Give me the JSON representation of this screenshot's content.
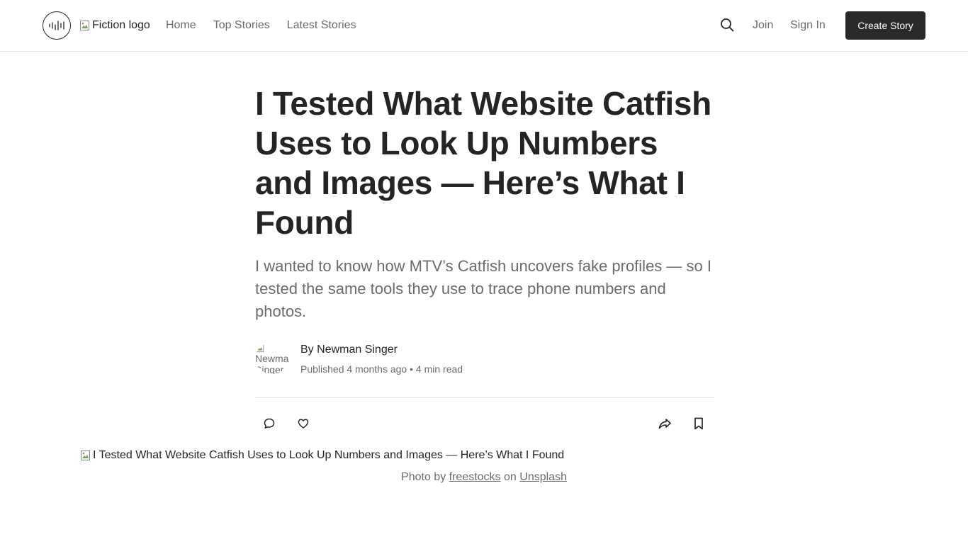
{
  "header": {
    "logo_alt": "Fiction logo",
    "nav": [
      "Home",
      "Top Stories",
      "Latest Stories"
    ],
    "join_label": "Join",
    "signin_label": "Sign In",
    "create_label": "Create Story"
  },
  "article": {
    "title": "I Tested What Website Catfish Uses to Look Up Numbers and Images — Here’s What I Found",
    "subtitle": "I wanted to know how MTV’s Catfish uncovers fake profiles — so I tested the same tools they use to trace phone numbers and photos.",
    "avatar_alt": "Newman Singer",
    "byline": "By Newman Singer",
    "published": "Published 4 months ago",
    "read_time": "4 min read",
    "hero_alt": "I Tested What Website Catfish Uses to Look Up Numbers and Images — Here’s What I Found",
    "caption": {
      "prefix": "Photo by",
      "photographer": "freestocks",
      "middle": "on",
      "source": "Unsplash"
    }
  },
  "colors": {
    "text": "#242424",
    "muted": "#6b6b6b",
    "button_bg": "#2a2a2a",
    "divider": "#e6e6e6"
  },
  "icons": [
    "logo-wave-icon",
    "search-icon",
    "comment-icon",
    "heart-icon",
    "share-icon",
    "bookmark-icon",
    "broken-image-icon"
  ]
}
